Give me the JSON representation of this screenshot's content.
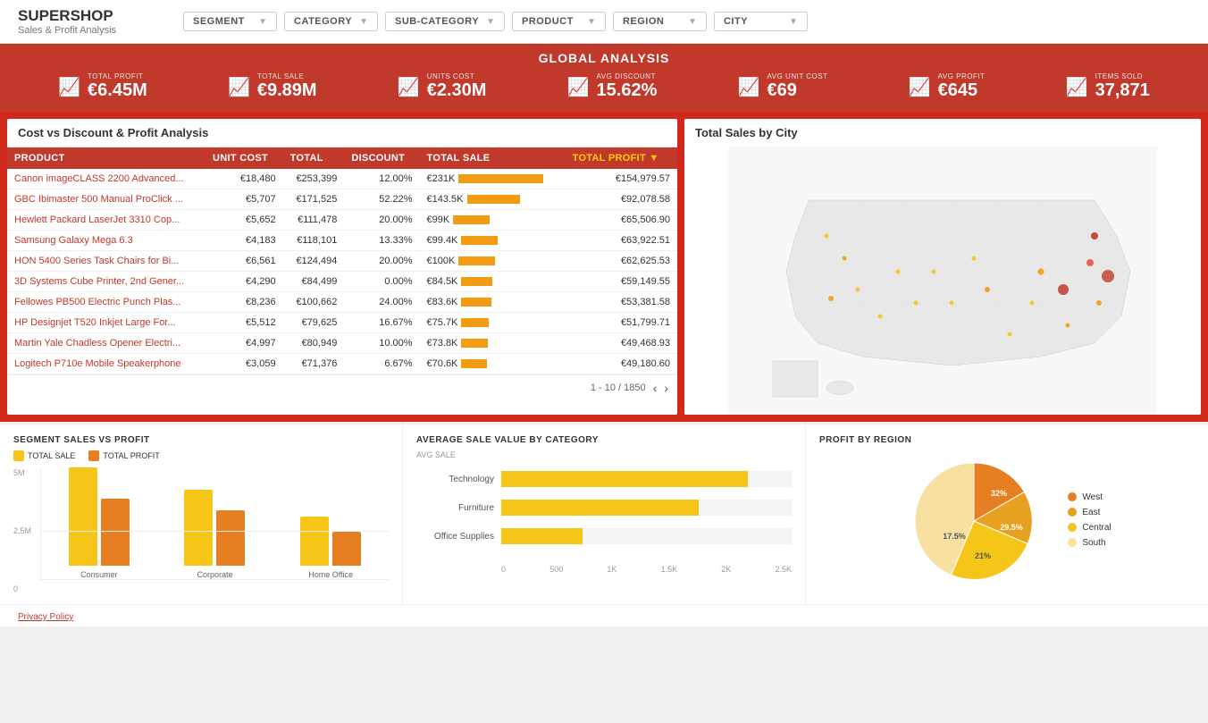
{
  "brand": {
    "title": "SUPERSHOP",
    "subtitle": "Sales & Profit Analysis"
  },
  "filters": [
    {
      "label": "SEGMENT",
      "id": "segment"
    },
    {
      "label": "CATEGORY",
      "id": "category"
    },
    {
      "label": "SUB-CATEGORY",
      "id": "sub-category"
    },
    {
      "label": "PRODUCT",
      "id": "product"
    },
    {
      "label": "REGION",
      "id": "region"
    },
    {
      "label": "CITY",
      "id": "city"
    }
  ],
  "global": {
    "title": "GLOBAL ANALYSIS",
    "kpis": [
      {
        "id": "total-profit",
        "label": "TOTAL PROFIT",
        "value": "€6.45M"
      },
      {
        "id": "total-sale",
        "label": "TOTAL SALE",
        "value": "€9.89M"
      },
      {
        "id": "units-cost",
        "label": "UNITS COST",
        "value": "€2.30M"
      },
      {
        "id": "avg-discount",
        "label": "AVG DISCOUNT",
        "value": "15.62%"
      },
      {
        "id": "avg-unit-cost",
        "label": "AVG UNIT COST",
        "value": "€69"
      },
      {
        "id": "avg-profit",
        "label": "AVG PROFIT",
        "value": "€645"
      },
      {
        "id": "items-sold",
        "label": "ITEMS SOLD",
        "value": "37,871"
      }
    ]
  },
  "table": {
    "title": "Cost vs Discount & Profit Analysis",
    "columns": [
      "PRODUCT",
      "UNIT COST",
      "TOTAL",
      "DISCOUNT",
      "TOTAL SALE",
      "TOTAL PROFIT ▼"
    ],
    "rows": [
      {
        "product": "Canon imageCLASS 2200 Advanced...",
        "unit_cost": "€18,480",
        "total": "€253,399",
        "discount": "12.00%",
        "total_sale": "€231K",
        "bar": 95,
        "profit": "€154,979.57"
      },
      {
        "product": "GBC Ibimaster 500 Manual ProClick ...",
        "unit_cost": "€5,707",
        "total": "€171,525",
        "discount": "52.22%",
        "total_sale": "€143.5K",
        "bar": 59,
        "profit": "€92,078.58"
      },
      {
        "product": "Hewlett Packard LaserJet 3310 Cop...",
        "unit_cost": "€5,652",
        "total": "€111,478",
        "discount": "20.00%",
        "total_sale": "€99K",
        "bar": 41,
        "profit": "€65,506.90"
      },
      {
        "product": "Samsung Galaxy Mega 6.3",
        "unit_cost": "€4,183",
        "total": "€118,101",
        "discount": "13.33%",
        "total_sale": "€99.4K",
        "bar": 41,
        "profit": "€63,922.51"
      },
      {
        "product": "HON 5400 Series Task Chairs for Bi...",
        "unit_cost": "€6,561",
        "total": "€124,494",
        "discount": "20.00%",
        "total_sale": "€100K",
        "bar": 41,
        "profit": "€62,625.53"
      },
      {
        "product": "3D Systems Cube Printer, 2nd Gener...",
        "unit_cost": "€4,290",
        "total": "€84,499",
        "discount": "0.00%",
        "total_sale": "€84.5K",
        "bar": 35,
        "profit": "€59,149.55"
      },
      {
        "product": "Fellowes PB500 Electric Punch Plas...",
        "unit_cost": "€8,236",
        "total": "€100,662",
        "discount": "24.00%",
        "total_sale": "€83.6K",
        "bar": 34,
        "profit": "€53,381.58"
      },
      {
        "product": "HP Designjet T520 Inkjet Large For...",
        "unit_cost": "€5,512",
        "total": "€79,625",
        "discount": "16.67%",
        "total_sale": "€75.7K",
        "bar": 31,
        "profit": "€51,799.71"
      },
      {
        "product": "Martin Yale Chadless Opener Electri...",
        "unit_cost": "€4,997",
        "total": "€80,949",
        "discount": "10.00%",
        "total_sale": "€73.8K",
        "bar": 30,
        "profit": "€49,468.93"
      },
      {
        "product": "Logitech P710e Mobile Speakerphone",
        "unit_cost": "€3,059",
        "total": "€71,376",
        "discount": "6.67%",
        "total_sale": "€70.6K",
        "bar": 29,
        "profit": "€49,180.60"
      }
    ],
    "pagination": "1 - 10 / 1850"
  },
  "map": {
    "title": "Total Sales by City"
  },
  "segment_chart": {
    "title": "SEGMENT SALES VS PROFIT",
    "legend": [
      "TOTAL SALE",
      "TOTAL PROFIT"
    ],
    "y_labels": [
      "5M",
      "2.5M",
      "0"
    ],
    "groups": [
      {
        "label": "Consumer",
        "sale_h": 110,
        "profit_h": 75
      },
      {
        "label": "Corporate",
        "sale_h": 85,
        "profit_h": 62
      },
      {
        "label": "Home Office",
        "sale_h": 55,
        "profit_h": 38
      }
    ]
  },
  "avg_sale_chart": {
    "title": "AVERAGE SALE VALUE BY CATEGORY",
    "legend": "AVG SALE",
    "categories": [
      {
        "label": "Technology",
        "value": 85,
        "display": ""
      },
      {
        "label": "Furniture",
        "value": 68,
        "display": ""
      },
      {
        "label": "Office Supplies",
        "value": 28,
        "display": ""
      }
    ],
    "x_labels": [
      "0",
      "500",
      "1K",
      "1.5K",
      "2K",
      "2.5K"
    ]
  },
  "profit_region": {
    "title": "PROFIT BY REGION",
    "segments": [
      {
        "label": "West",
        "value": 32,
        "pct": "32%",
        "color": "#e67e22"
      },
      {
        "label": "East",
        "value": 29.5,
        "pct": "29.5%",
        "color": "#e8a020"
      },
      {
        "label": "Central",
        "value": 21,
        "pct": "21%",
        "color": "#f5c518"
      },
      {
        "label": "South",
        "value": 17.5,
        "pct": "17.5%",
        "color": "#f7e0a0"
      }
    ]
  },
  "privacy": "Privacy Policy"
}
